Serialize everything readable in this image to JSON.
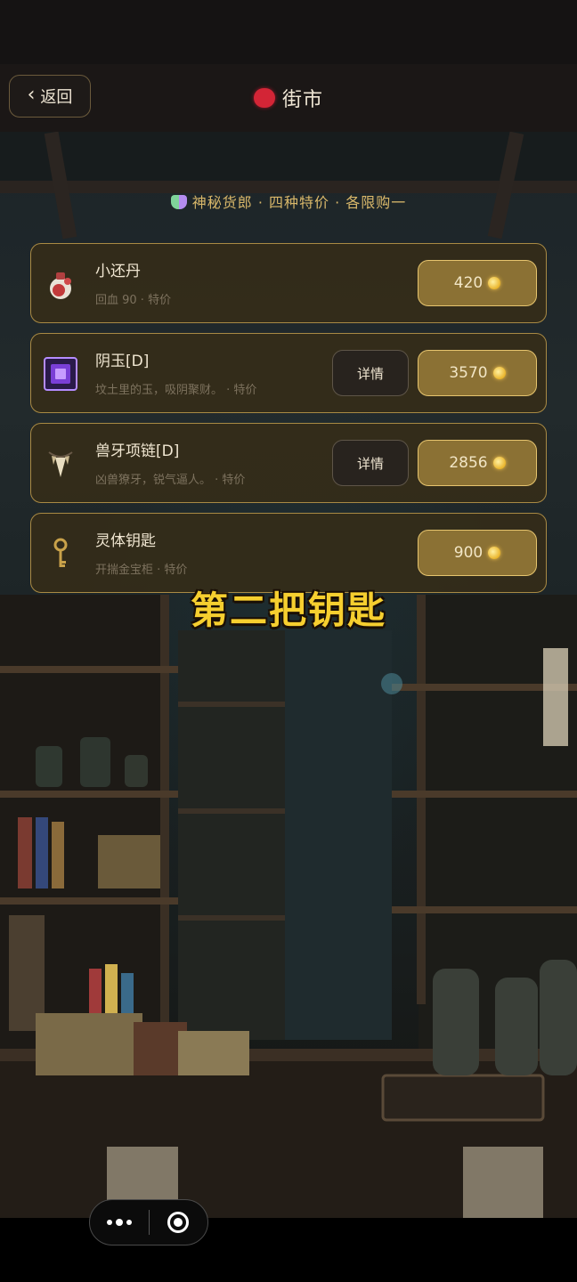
{
  "nav": {
    "back_label": "返回",
    "title": "街市"
  },
  "subtitle": "神秘货郎 · 四种特价 · 各限购一",
  "items": [
    {
      "name": "小还丹",
      "desc": "回血 90 · 特价",
      "price": "420",
      "detail_label": "",
      "icon": "potion-icon"
    },
    {
      "name": "阴玉[D]",
      "desc": "坟土里的玉，吸阴聚财。 · 特价",
      "price": "3570",
      "detail_label": "详情",
      "icon": "purple-jade-icon"
    },
    {
      "name": "兽牙项链[D]",
      "desc": "凶兽獠牙，锐气逼人。 · 特价",
      "price": "2856",
      "detail_label": "详情",
      "icon": "fang-necklace-icon"
    },
    {
      "name": "灵体钥匙",
      "desc": "开揣金宝柜 · 特价",
      "price": "900",
      "detail_label": "",
      "icon": "key-icon"
    }
  ],
  "caption": "第二把钥匙",
  "colors": {
    "accent_gold": "#e6c46e",
    "caption_yellow": "#f6cf2f",
    "lantern_red": "#d32536"
  }
}
